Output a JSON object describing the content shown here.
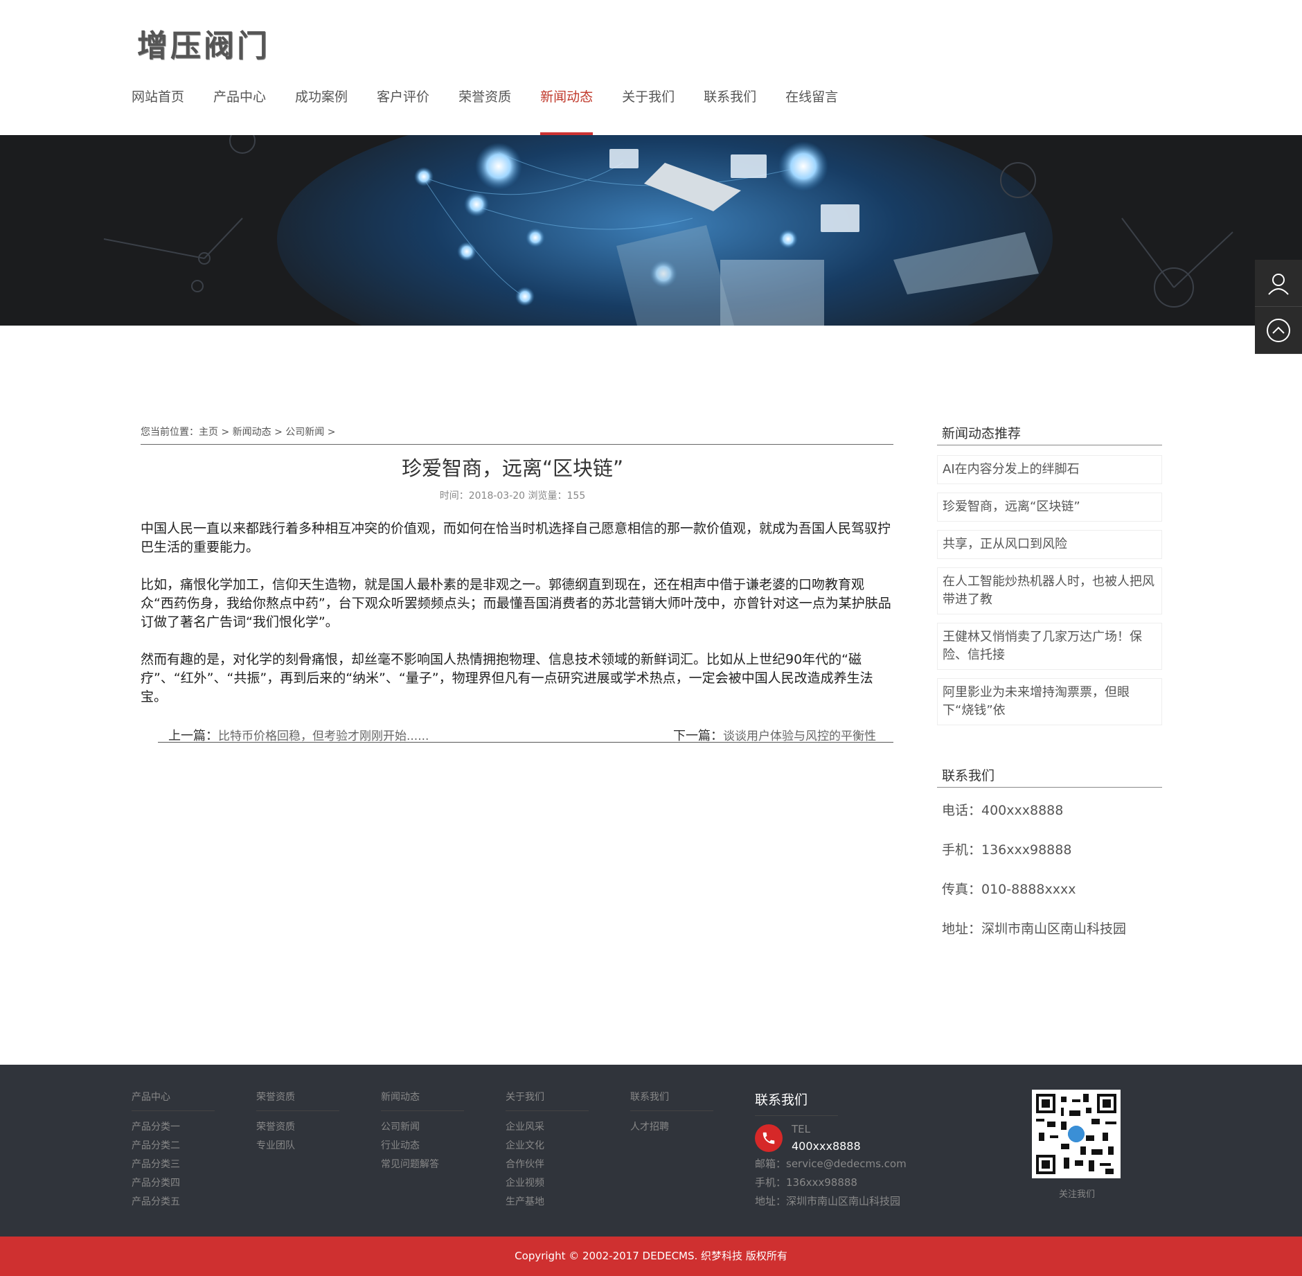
{
  "header": {
    "logo": "增压阀门",
    "nav": [
      "网站首页",
      "产品中心",
      "成功案例",
      "客户评价",
      "荣誉资质",
      "新闻动态",
      "关于我们",
      "联系我们",
      "在线留言"
    ],
    "active_nav": "新闻动态"
  },
  "side_tools": {
    "user_icon": "user-icon",
    "top_icon": "back-to-top-icon"
  },
  "breadcrumb": "您当前位置：主页 > 新闻动态 > 公司新闻 >",
  "article": {
    "title": "珍爱智商，远离“区块链”",
    "meta": "时间：2018-03-20 浏览量：155",
    "paragraphs": [
      "中国人民一直以来都践行着多种相互冲突的价值观，而如何在恰当时机选择自己愿意相信的那一款价值观，就成为吾国人民驾驭拧巴生活的重要能力。",
      "比如，痛恨化学加工，信仰天生造物，就是国人最朴素的是非观之一。郭德纲直到现在，还在相声中借于谦老婆的口吻教育观众“西药伤身，我给你熬点中药”，台下观众听罢频频点头；而最懂吾国消费者的苏北营销大师叶茂中，亦曾针对这一点为某护肤品订做了著名广告词“我们恨化学”。",
      "然而有趣的是，对化学的刻骨痛恨，却丝毫不影响国人热情拥抱物理、信息技术领域的新鲜词汇。比如从上世纪90年代的“磁疗”、“红外”、“共振”，再到后来的“纳米”、“量子”，物理界但凡有一点研究进展或学术热点，一定会被中国人民改造成养生法宝。"
    ],
    "prev_label": "上一篇：",
    "prev_title": "比特币价格回稳，但考验才刚刚开始......",
    "next_label": "下一篇：",
    "next_title": "谈谈用户体验与风控的平衡性"
  },
  "sidebar": {
    "rec_title": "新闻动态推荐",
    "rec_items": [
      "AI在内容分发上的绊脚石",
      "珍爱智商，远离“区块链”",
      "共享，正从风口到风险",
      "在人工智能炒热机器人时，也被人把风带进了教",
      "王健林又悄悄卖了几家万达广场！保险、信托接",
      "阿里影业为未来增持淘票票，但眼下“烧钱”依"
    ],
    "contact_title": "联系我们",
    "contact_lines": [
      "电话：400xxx8888",
      "手机：136xxx98888",
      "传真：010-8888xxxx",
      "地址：深圳市南山区南山科技园"
    ]
  },
  "footer": {
    "columns": [
      {
        "title": "产品中心",
        "links": [
          "产品分类一",
          "产品分类二",
          "产品分类三",
          "产品分类四",
          "产品分类五"
        ]
      },
      {
        "title": "荣誉资质",
        "links": [
          "荣誉资质",
          "专业团队"
        ]
      },
      {
        "title": "新闻动态",
        "links": [
          "公司新闻",
          "行业动态",
          "常见问题解答"
        ]
      },
      {
        "title": "关于我们",
        "links": [
          "企业风采",
          "企业文化",
          "合作伙伴",
          "企业视频",
          "生产基地"
        ]
      },
      {
        "title": "联系我们",
        "links": [
          "人才招聘"
        ]
      }
    ],
    "contact_title": "联系我们",
    "tel_label": "TEL",
    "tel_number": "400xxx8888",
    "email": "邮箱：service@dedecms.com",
    "mobile": "手机：136xxx98888",
    "address": "地址：深圳市南山区南山科技园",
    "qr_caption": "关注我们",
    "copyright": "Copyright © 2002-2017 DEDECMS. 织梦科技 版权所有"
  }
}
